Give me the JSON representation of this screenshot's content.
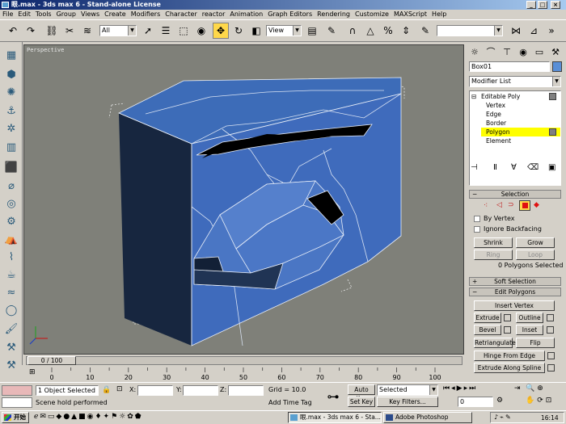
{
  "window": {
    "title": "眼.max - 3ds max 6 - Stand-alone License",
    "minimize_glyph": "_",
    "maximize_glyph": "□",
    "close_glyph": "×"
  },
  "menu": [
    "File",
    "Edit",
    "Tools",
    "Group",
    "Views",
    "Create",
    "Modifiers",
    "Character",
    "reactor",
    "Animation",
    "Graph Editors",
    "Rendering",
    "Customize",
    "MAXScript",
    "Help"
  ],
  "toolbar": {
    "selection_filter": "All",
    "ref_coord": "View",
    "named_selection": ""
  },
  "viewport": {
    "label": "Perspective"
  },
  "command_panel": {
    "object_name": "Box01",
    "object_color": "#5a8fd6",
    "modifier_list_label": "Modifier List",
    "stack": {
      "base": "Editable Poly",
      "items": [
        "Vertex",
        "Edge",
        "Border",
        "Polygon",
        "Element"
      ],
      "selected": "Polygon"
    },
    "selection_rollout": {
      "title": "Selection",
      "by_vertex": "By Vertex",
      "ignore_backfacing": "Ignore Backfacing",
      "shrink": "Shrink",
      "grow": "Grow",
      "ring": "Ring",
      "loop": "Loop",
      "status": "0 Polygons Selected"
    },
    "soft_selection_title": "Soft Selection",
    "edit_polygons": {
      "title": "Edit Polygons",
      "insert_vertex": "Insert Vertex",
      "extrude": "Extrude",
      "outline": "Outline",
      "bevel": "Bevel",
      "inset": "Inset",
      "retriangulate": "Retriangulate",
      "flip": "Flip",
      "hinge_from_edge": "Hinge From Edge",
      "extrude_along_spline": "Extrude Along Spline"
    }
  },
  "time": {
    "slider_label": "0 / 100",
    "ticks": [
      "0",
      "10",
      "20",
      "30",
      "40",
      "50",
      "60",
      "70",
      "80",
      "90",
      "100"
    ]
  },
  "status": {
    "selection_count": "1 Object Selected",
    "prompt": "Scene hold performed",
    "x_label": "X:",
    "y_label": "Y:",
    "z_label": "Z:",
    "grid": "Grid = 10.0",
    "add_time_tag": "Add Time Tag",
    "auto_key": "Auto Key",
    "set_key": "Set Key",
    "key_mode": "Selected",
    "key_filters": "Key Filters...",
    "frame": "0"
  },
  "taskbar": {
    "start": "开始",
    "tasks": [
      "眼.max - 3ds max 6 - Sta...",
      "Adobe Photoshop"
    ],
    "clock": "16:14"
  }
}
